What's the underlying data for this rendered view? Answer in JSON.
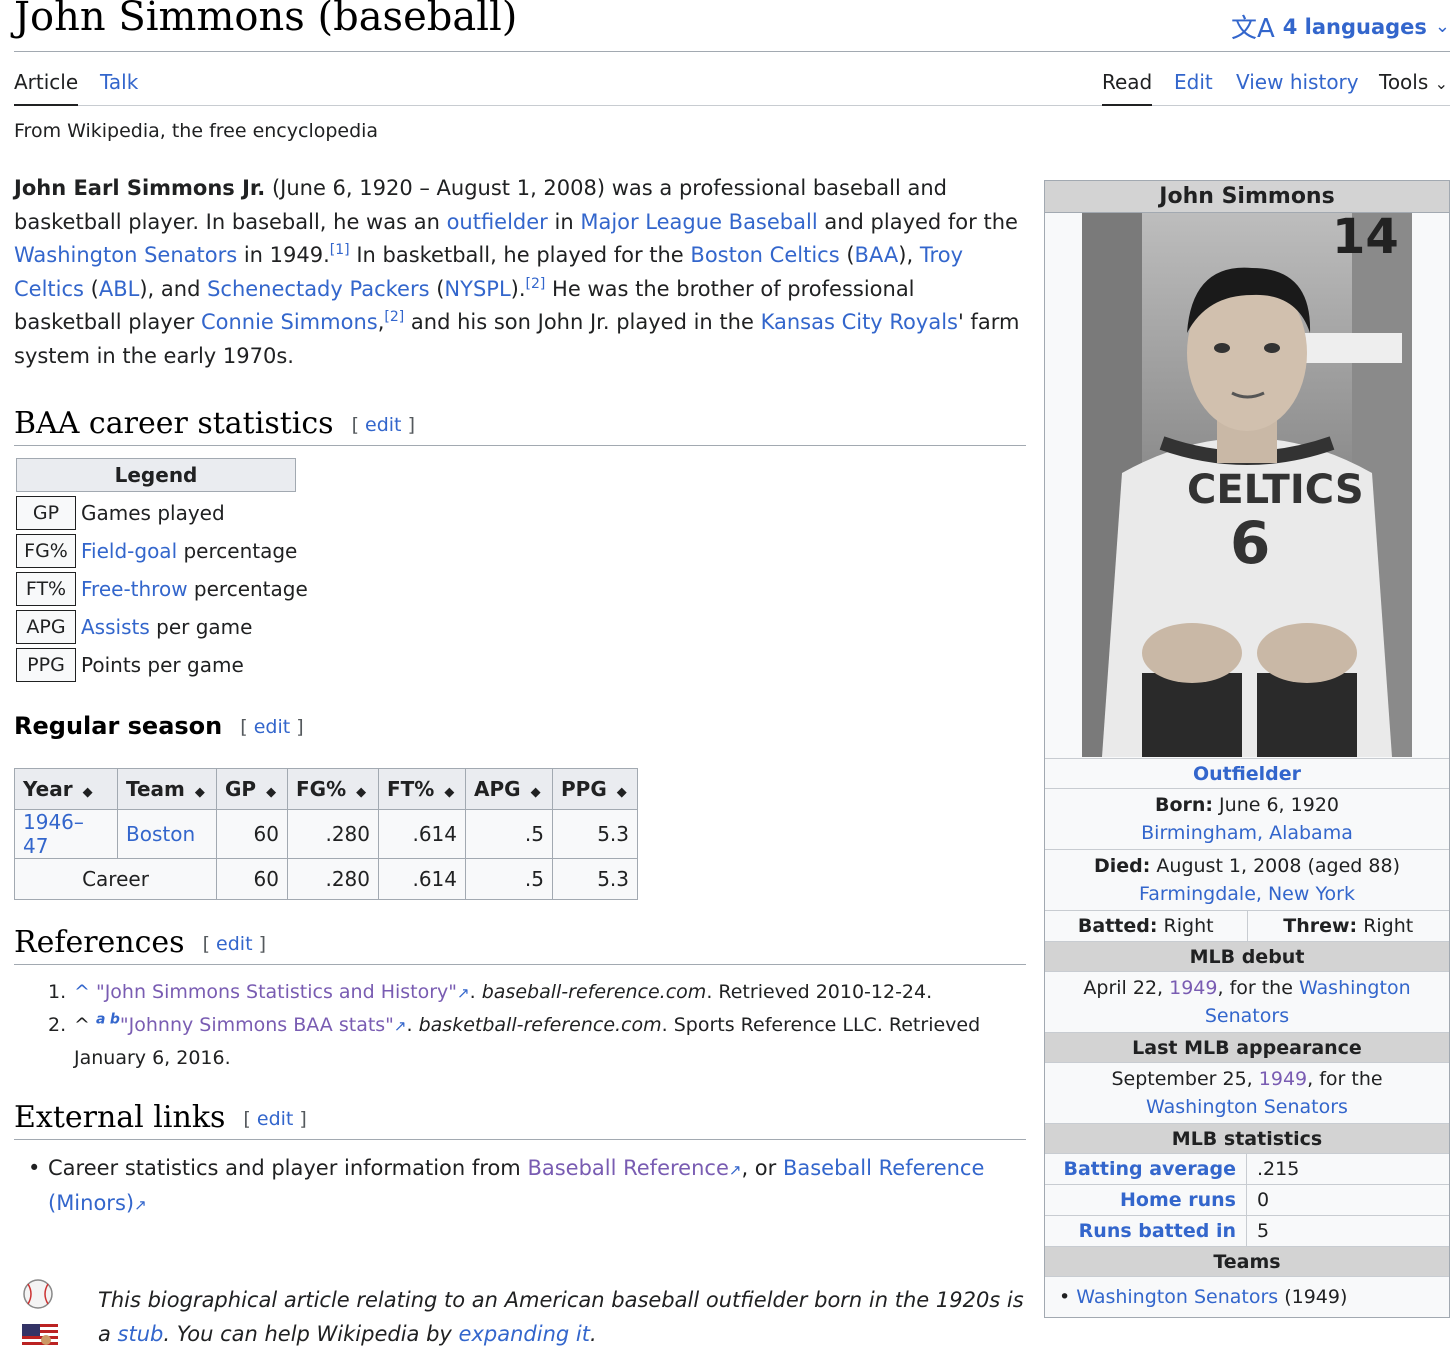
{
  "header": {
    "title": "John Simmons (baseball)",
    "languages": "4 languages"
  },
  "tabs": {
    "article": "Article",
    "talk": "Talk",
    "read": "Read",
    "edit": "Edit",
    "view_history": "View history",
    "tools": "Tools"
  },
  "tagline": "From Wikipedia, the free encyclopedia",
  "lead": {
    "name": "John Earl Simmons Jr.",
    "t1": " (June 6, 1920 – August 1, 2008) was a professional baseball and basketball player. In baseball, he was an ",
    "outfielder": "outfielder",
    "t2": " in ",
    "mlb": "Major League Baseball",
    "t3": " and played for the ",
    "senators": "Washington Senators",
    "t4": " in 1949.",
    "ref1": "[1]",
    "t5": " In basketball, he played for the ",
    "celtics": "Boston Celtics",
    "t6": " (",
    "baa": "BAA",
    "t7": "), ",
    "troy": "Troy Celtics",
    "t8": " (",
    "abl": "ABL",
    "t9": "), and ",
    "packers": "Schenectady Packers",
    "t10": " (",
    "nyspl": "NYSPL",
    "t11": ").",
    "ref2": "[2]",
    "t12": " He was the brother of professional basketball player ",
    "connie": "Connie Simmons",
    "t13": ",",
    "ref2b": "[2]",
    "t14": " and his son John Jr. played in the ",
    "royals": "Kansas City Royals",
    "t15": "' farm system in the early 1970s."
  },
  "sections": {
    "baa": "BAA career statistics",
    "regular": "Regular season",
    "references": "References",
    "external": "External links",
    "edit": "edit",
    "bracket_open": "[",
    "bracket_close": "]"
  },
  "legend": {
    "title": "Legend",
    "rows": [
      {
        "abbr": "GP",
        "link": "",
        "text": "Games played"
      },
      {
        "abbr": "FG%",
        "link": "Field-goal",
        "text": " percentage"
      },
      {
        "abbr": "FT%",
        "link": "Free-throw",
        "text": " percentage"
      },
      {
        "abbr": "APG",
        "link": "Assists",
        "text": " per game"
      },
      {
        "abbr": "PPG",
        "link": "",
        "text": "Points per game"
      }
    ]
  },
  "stats": {
    "headers": [
      "Year",
      "Team",
      "GP",
      "FG%",
      "FT%",
      "APG",
      "PPG"
    ],
    "row1": {
      "year": "1946–47",
      "team": "Boston",
      "gp": "60",
      "fg": ".280",
      "ft": ".614",
      "apg": ".5",
      "ppg": "5.3"
    },
    "career": {
      "label": "Career",
      "gp": "60",
      "fg": ".280",
      "ft": ".614",
      "apg": ".5",
      "ppg": "5.3"
    }
  },
  "references": {
    "r1": {
      "num": "1.",
      "caret": "^",
      "title": "\"John Simmons Statistics and History\"",
      "site": "baseball-reference.com",
      "rest": ". Retrieved 2010-12-24."
    },
    "r2": {
      "num": "2.",
      "caret": "^",
      "a": "a",
      "b": "b",
      "title": "\"Johnny Simmons BAA stats\"",
      "site": "basketball-reference.com",
      "rest": ". Sports Reference LLC. Retrieved January 6, 2016."
    }
  },
  "external": {
    "t1": "Career statistics and player information from ",
    "l1": "Baseball Reference",
    "t2": ", or ",
    "l2": "Baseball Reference (Minors)"
  },
  "stub": {
    "t1": "This biographical article relating to an American baseball outfielder born in the 1920s is a ",
    "stub": "stub",
    "t2": ". You can help Wikipedia by ",
    "expand": "expanding it",
    "t3": "."
  },
  "infobox": {
    "title": "John Simmons",
    "position": "Outfielder",
    "born_label": "Born:",
    "born_date": " June 6, 1920",
    "born_place": "Birmingham, Alabama",
    "died_label": "Died:",
    "died_date": " August 1, 2008 (aged 88)",
    "died_place": "Farmingdale, New York",
    "batted_label": "Batted:",
    "batted": " Right",
    "threw_label": "Threw:",
    "threw": " Right",
    "debut_head": "MLB debut",
    "debut_t1": "April 22, ",
    "debut_year": "1949",
    "debut_t2": ", for the ",
    "debut_team": "Washington Senators",
    "last_head": "Last MLB appearance",
    "last_t1": "September 25, ",
    "last_year": "1949",
    "last_t2": ", for the ",
    "last_team": "Washington Senators",
    "stats_head": "MLB statistics",
    "stats": [
      {
        "k": "Batting average",
        "v": ".215"
      },
      {
        "k": "Home runs",
        "v": "0"
      },
      {
        "k": "Runs batted in",
        "v": "5"
      }
    ],
    "teams_head": "Teams",
    "team": "Washington Senators",
    "team_years": " (1949)"
  }
}
